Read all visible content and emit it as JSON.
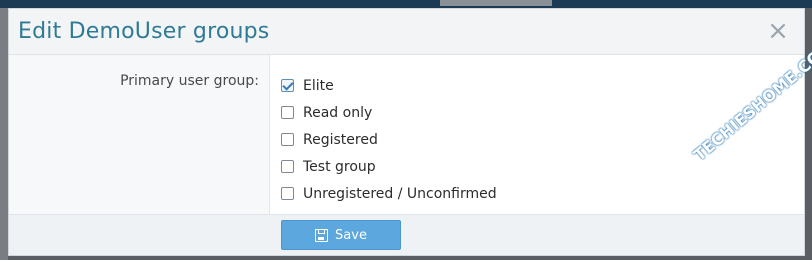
{
  "modal": {
    "title": "Edit DemoUser groups",
    "close_glyph": "×"
  },
  "form": {
    "primary_group_label": "Primary user group:",
    "options": [
      {
        "label": "Elite",
        "checked": true
      },
      {
        "label": "Read only",
        "checked": false
      },
      {
        "label": "Registered",
        "checked": false
      },
      {
        "label": "Test group",
        "checked": false
      },
      {
        "label": "Unregistered / Unconfirmed",
        "checked": false
      }
    ]
  },
  "footer": {
    "save_label": "Save",
    "save_icon": "floppy-disk-icon"
  },
  "watermark": {
    "text": "TECHIESHOME.COM"
  },
  "colors": {
    "title": "#2f7b95",
    "save_button": "#5ca8de",
    "overlay": "#5b5f63"
  }
}
